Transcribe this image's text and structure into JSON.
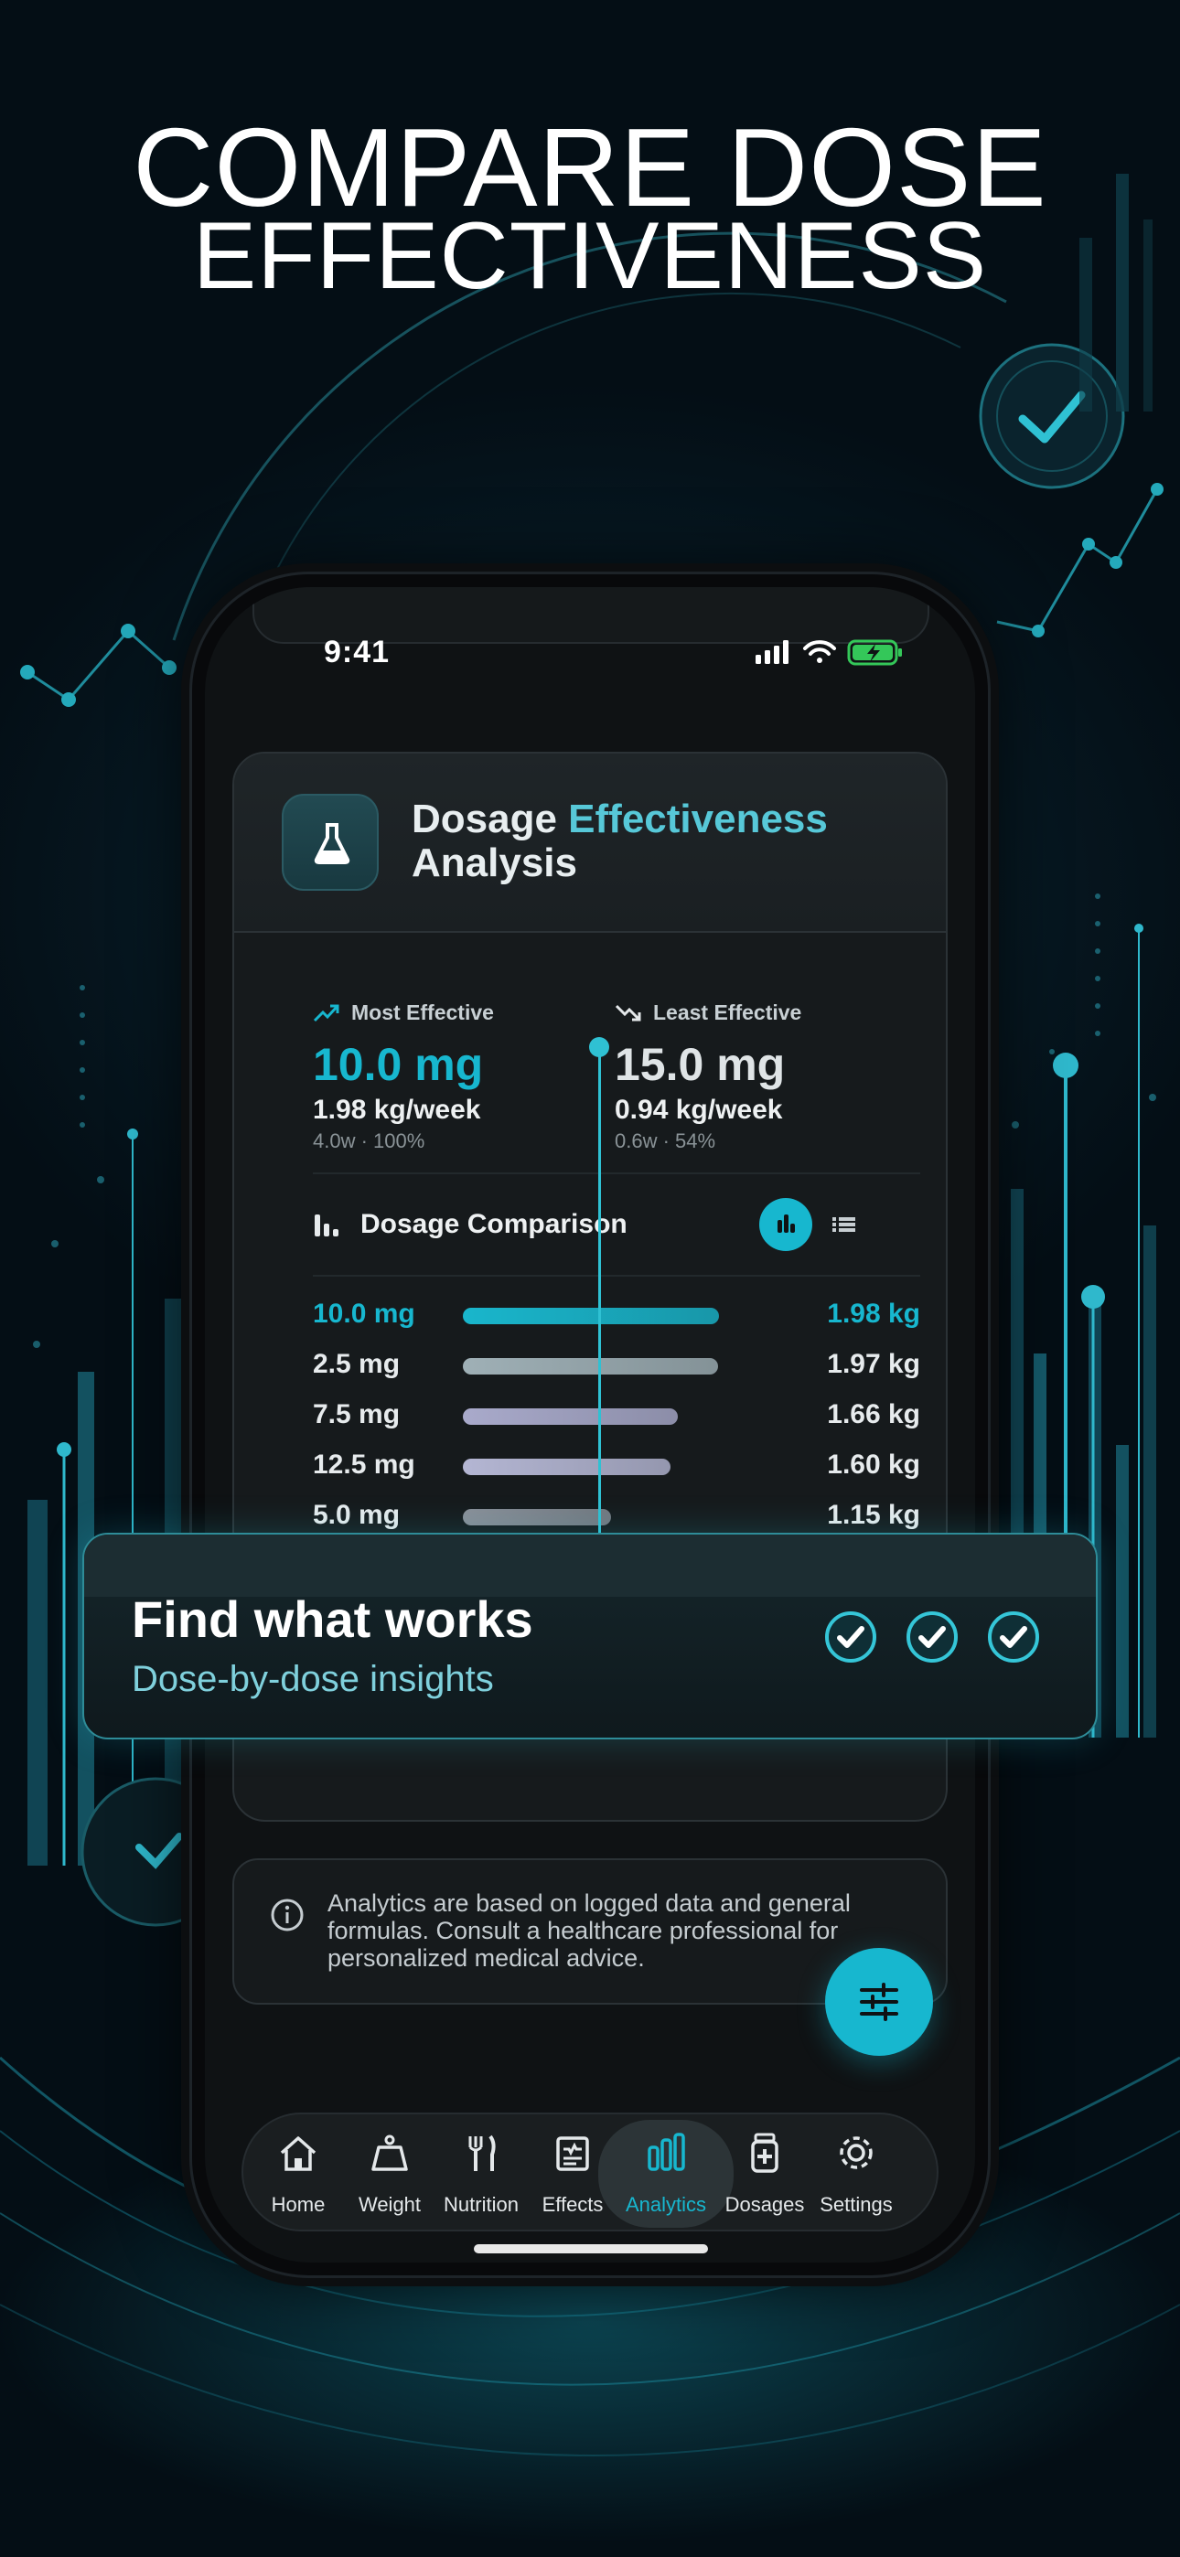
{
  "headline": {
    "line1": "COMPARE DOSE",
    "line2": "EFFECTIVENESS"
  },
  "status_bar": {
    "time": "9:41",
    "icons": [
      "signal-icon",
      "wifi-icon",
      "battery-charging-icon"
    ]
  },
  "card": {
    "title_part1": "Dosage ",
    "title_accent": "Effectiveness",
    "title_part2": "Analysis",
    "icon": "flask-icon"
  },
  "most_effective": {
    "label": "Most Effective",
    "dose": "10.0 mg",
    "rate": "1.98 kg/week",
    "meta": "4.0w · 100%"
  },
  "least_effective": {
    "label": "Least Effective",
    "dose": "15.0 mg",
    "rate": "0.94 kg/week",
    "meta": "0.6w · 54%"
  },
  "comparison": {
    "title": "Dosage Comparison",
    "view_modes": [
      "chart-view-icon",
      "list-view-icon"
    ],
    "rows": [
      {
        "dose": "10.0 mg",
        "value": "1.98 kg",
        "fraction": 1.0,
        "color": "#19b6cc",
        "best": true
      },
      {
        "dose": "2.5 mg",
        "value": "1.97 kg",
        "fraction": 0.995,
        "color": "#9fb0b6",
        "best": false
      },
      {
        "dose": "7.5 mg",
        "value": "1.66 kg",
        "fraction": 0.84,
        "color": "#a9aacb",
        "best": false
      },
      {
        "dose": "12.5 mg",
        "value": "1.60 kg",
        "fraction": 0.81,
        "color": "#b4b6d3",
        "best": false
      },
      {
        "dose": "5.0 mg",
        "value": "1.15 kg",
        "fraction": 0.58,
        "color": "#8a8f98",
        "best": false
      }
    ]
  },
  "info": {
    "text": "Analytics are based on logged data and general formulas. Consult a healthcare professional for personalized medical advice."
  },
  "tabs": [
    {
      "label": "Home",
      "icon": "home-icon",
      "active": false
    },
    {
      "label": "Weight",
      "icon": "scale-icon",
      "active": false
    },
    {
      "label": "Nutrition",
      "icon": "utensils-icon",
      "active": false
    },
    {
      "label": "Effects",
      "icon": "clipboard-icon",
      "active": false
    },
    {
      "label": "Analytics",
      "icon": "bar-chart-icon",
      "active": true
    },
    {
      "label": "Dosages",
      "icon": "medicine-bottle-icon",
      "active": false
    },
    {
      "label": "Settings",
      "icon": "gear-icon",
      "active": false
    }
  ],
  "banner": {
    "title": "Find what works",
    "subtitle": "Dose-by-dose insights"
  },
  "colors": {
    "accent": "#17b7cf",
    "background": "#040e15",
    "card": "#161a1c"
  }
}
